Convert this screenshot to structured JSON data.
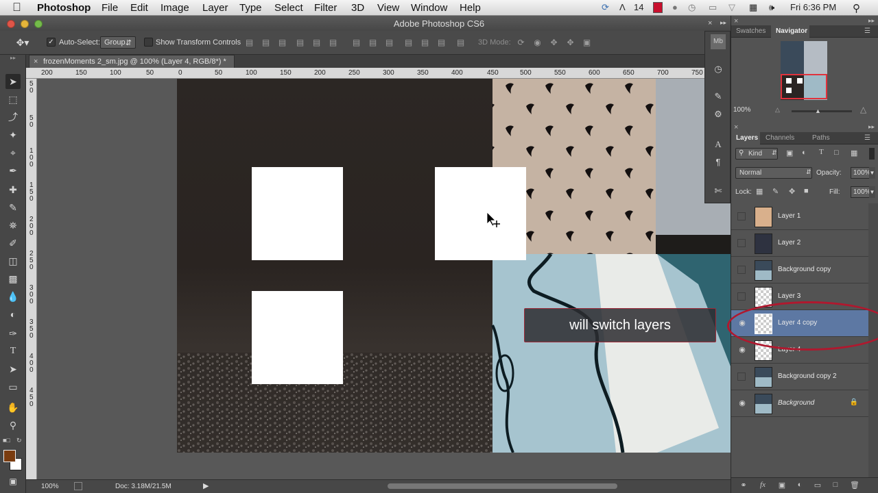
{
  "menubar": {
    "app": "Photoshop",
    "items": [
      "File",
      "Edit",
      "Image",
      "Layer",
      "Type",
      "Select",
      "Filter",
      "3D",
      "View",
      "Window",
      "Help"
    ],
    "battery_text": "14",
    "clock": "Fri 6:36 PM"
  },
  "window": {
    "title": "Adobe Photoshop CS6"
  },
  "options": {
    "auto_select_label": "Auto-Select:",
    "auto_select_checked": true,
    "auto_select_value": "Group",
    "show_transform_label": "Show Transform Controls",
    "mode_3d_label": "3D Mode:"
  },
  "document": {
    "tab_title": "frozenMoments 2_sm.jpg @ 100% (Layer 4, RGB/8*) *",
    "zoom": "100%",
    "doc_size": "Doc: 3.18M/21.5M"
  },
  "rulers": {
    "h_ticks": [
      "200",
      "150",
      "100",
      "50",
      "0",
      "50",
      "100",
      "150",
      "200",
      "250",
      "300",
      "350",
      "400",
      "450",
      "500",
      "550",
      "600",
      "650",
      "700",
      "750"
    ],
    "v_ticks": [
      "5",
      "0",
      "5",
      "0",
      "1",
      "0",
      "0",
      "1",
      "5",
      "0",
      "2",
      "0",
      "0",
      "2",
      "5",
      "0",
      "3",
      "0",
      "0",
      "3",
      "5",
      "0",
      "4",
      "0",
      "0",
      "4",
      "5",
      "0"
    ]
  },
  "navigator": {
    "tabs": [
      "Swatches",
      "Navigator"
    ],
    "active_tab": "Navigator",
    "zoom": "100%"
  },
  "layers_panel": {
    "tabs": [
      "Layers",
      "Channels",
      "Paths"
    ],
    "active_tab": "Layers",
    "kind_label": "Kind",
    "blend_mode": "Normal",
    "opacity_label": "Opacity:",
    "opacity_value": "100%",
    "lock_label": "Lock:",
    "fill_label": "Fill:",
    "fill_value": "100%",
    "layers": [
      {
        "name": "Layer 1",
        "visible": false,
        "selected": false,
        "thumb": "photo-orange"
      },
      {
        "name": "Layer 2",
        "visible": false,
        "selected": false,
        "thumb": "photo-dark"
      },
      {
        "name": "Background copy",
        "visible": false,
        "selected": false,
        "thumb": "photo-collage"
      },
      {
        "name": "Layer 3",
        "visible": false,
        "selected": false,
        "thumb": "transparent"
      },
      {
        "name": "Layer 4 copy",
        "visible": true,
        "selected": true,
        "thumb": "transparent"
      },
      {
        "name": "Layer 4",
        "visible": true,
        "selected": false,
        "thumb": "transparent"
      },
      {
        "name": "Background copy 2",
        "visible": false,
        "selected": false,
        "thumb": "photo-collage"
      },
      {
        "name": "Background",
        "visible": true,
        "selected": false,
        "thumb": "photo-collage",
        "locked": true
      }
    ]
  },
  "annotation": {
    "text": "will switch layers"
  },
  "colors": {
    "foreground": "#7a3c10",
    "background": "#ffffff",
    "selection": "#5d78a3",
    "highlight_ring": "#b0182e"
  }
}
